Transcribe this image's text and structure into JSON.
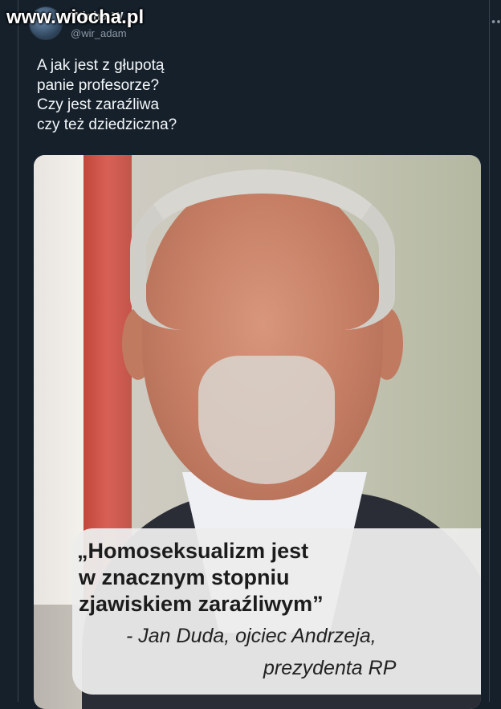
{
  "tweet": {
    "display_name": "Wicha W",
    "handle": "@wir_adam",
    "text_lines": [
      "A jak jest z głupotą",
      "panie profesorze?",
      "Czy jest zaraźliwa",
      "czy też dziedziczna?"
    ]
  },
  "watermark": "www.wiocha.pl",
  "media": {
    "quote_lines": [
      "„Homoseksualizm jest",
      "w znacznym stopniu",
      "zjawiskiem zaraźliwym”"
    ],
    "attribution_lines": [
      "- Jan Duda, ojciec Andrzeja,",
      "prezydenta RP"
    ]
  },
  "icons": {
    "more": "more-options-icon",
    "avatar": "avatar"
  },
  "colors": {
    "background": "#15202b",
    "text": "#f5f8fa",
    "secondary_text": "#8b98a5"
  }
}
